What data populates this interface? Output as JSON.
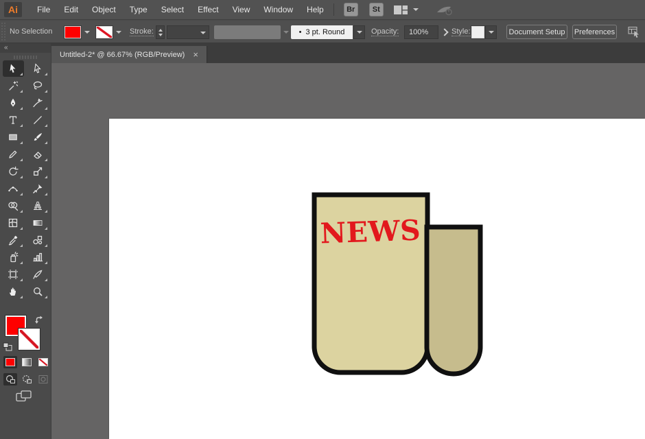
{
  "app": {
    "logo_text": "Ai"
  },
  "menubar": {
    "items": [
      "File",
      "Edit",
      "Object",
      "Type",
      "Select",
      "Effect",
      "View",
      "Window",
      "Help"
    ],
    "bridge_button": "Br",
    "stock_button": "St"
  },
  "controlbar": {
    "selection_status": "No Selection",
    "fill_color": "#FF0000",
    "stroke_label": "Stroke:",
    "brush_dot": "•",
    "brush_preset": "3 pt. Round",
    "opacity_label": "Opacity:",
    "opacity_value": "100%",
    "style_label": "Style:",
    "buttons": {
      "document_setup": "Document Setup",
      "preferences": "Preferences"
    }
  },
  "tabbar": {
    "active_tab": {
      "title": "Untitled-2* @ 66.67% (RGB/Preview)",
      "close_glyph": "×"
    }
  },
  "toolbar": {
    "collapse_glyph": "«",
    "fill_color": "#FF0000",
    "tools": [
      {
        "name": "selection",
        "label": "Selection Tool",
        "active": true
      },
      {
        "name": "direct-selection",
        "label": "Direct Selection Tool"
      },
      {
        "name": "magic-wand",
        "label": "Magic Wand Tool"
      },
      {
        "name": "lasso",
        "label": "Lasso Tool"
      },
      {
        "name": "pen",
        "label": "Pen Tool"
      },
      {
        "name": "curvature",
        "label": "Curvature Tool"
      },
      {
        "name": "type",
        "label": "Type Tool"
      },
      {
        "name": "line-segment",
        "label": "Line Segment Tool"
      },
      {
        "name": "rectangle",
        "label": "Rectangle Tool"
      },
      {
        "name": "paintbrush",
        "label": "Paintbrush Tool"
      },
      {
        "name": "pencil",
        "label": "Pencil Tool"
      },
      {
        "name": "eraser",
        "label": "Eraser Tool"
      },
      {
        "name": "rotate",
        "label": "Rotate Tool"
      },
      {
        "name": "scale",
        "label": "Scale Tool"
      },
      {
        "name": "width",
        "label": "Width Tool"
      },
      {
        "name": "free-transform",
        "label": "Free Transform Tool"
      },
      {
        "name": "shape-builder",
        "label": "Shape Builder Tool"
      },
      {
        "name": "perspective-grid",
        "label": "Perspective Grid Tool"
      },
      {
        "name": "mesh",
        "label": "Mesh Tool"
      },
      {
        "name": "gradient",
        "label": "Gradient Tool"
      },
      {
        "name": "eyedropper",
        "label": "Eyedropper Tool"
      },
      {
        "name": "blend",
        "label": "Blend Tool"
      },
      {
        "name": "symbol-sprayer",
        "label": "Symbol Sprayer Tool"
      },
      {
        "name": "column-graph",
        "label": "Column Graph Tool"
      },
      {
        "name": "artboard",
        "label": "Artboard Tool"
      },
      {
        "name": "slice",
        "label": "Slice Tool"
      },
      {
        "name": "hand",
        "label": "Hand Tool"
      },
      {
        "name": "zoom",
        "label": "Zoom Tool"
      }
    ]
  },
  "canvas": {
    "artwork": {
      "headline": "NEWS",
      "headline_color": "#E2181D",
      "page_fill": "#DCD3A0",
      "roll_fill": "#C6BC8D",
      "outline_color": "#101010"
    }
  }
}
